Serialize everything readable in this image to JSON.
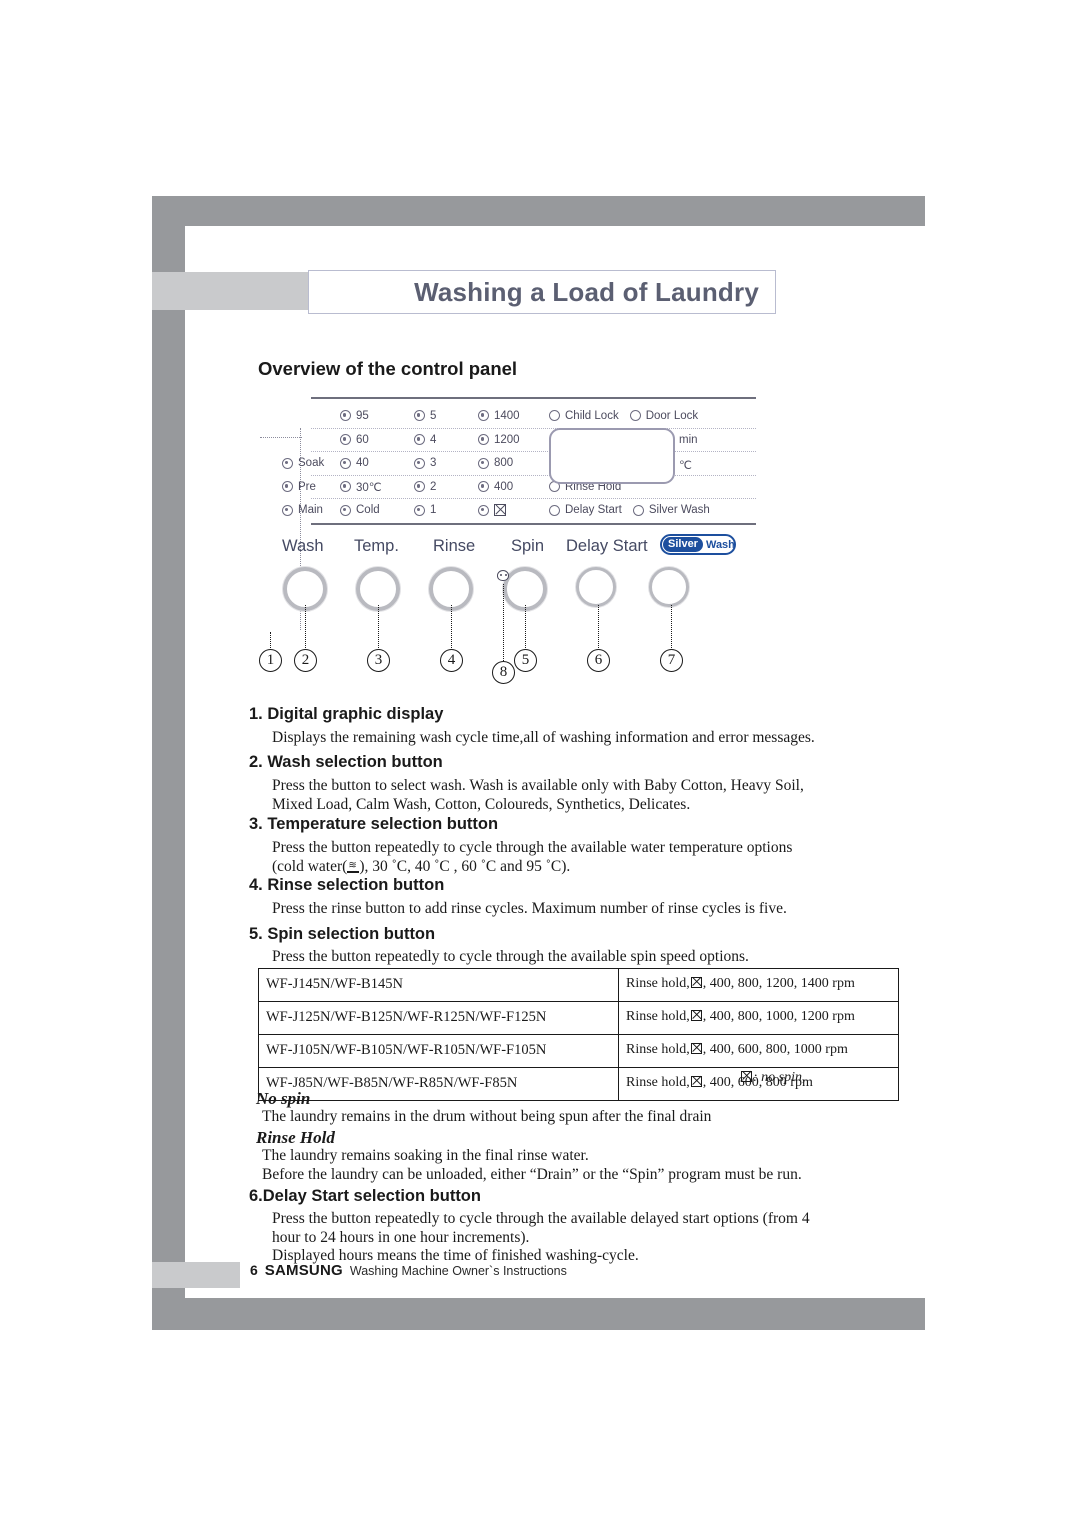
{
  "page": {
    "title": "Washing a Load of Laundry",
    "section_heading": "Overview of the control panel"
  },
  "control_panel": {
    "led_rows": [
      {
        "wash": "",
        "temp": "95",
        "rinse": "5",
        "spin": "1400",
        "spin_icon": false
      },
      {
        "wash": "",
        "temp": "60",
        "rinse": "4",
        "spin": "1200",
        "spin_icon": false
      },
      {
        "wash": "Soak",
        "temp": "40",
        "rinse": "3",
        "spin": "800",
        "spin_icon": false
      },
      {
        "wash": "Pre",
        "temp": "30℃",
        "rinse": "2",
        "spin": "400",
        "spin_icon": false
      },
      {
        "wash": "Main",
        "temp": "Cold",
        "rinse": "1",
        "spin": "",
        "spin_icon": true
      }
    ],
    "status_lights": {
      "child_lock": "Child Lock",
      "door_lock": "Door Lock",
      "rinse_hold": "Rinse Hold",
      "delay_start": "Delay Start",
      "silver_wash": "Silver Wash"
    },
    "display_units": {
      "min": "min",
      "celsius": "℃"
    },
    "buttons": [
      {
        "label": "Wash",
        "callout": "②"
      },
      {
        "label": "Temp.",
        "callout": "③"
      },
      {
        "label": "Rinse",
        "callout": "④"
      },
      {
        "label": "Spin",
        "callout": "⑤"
      },
      {
        "label": "Delay Start",
        "callout": "⑥"
      }
    ],
    "silver_wash_badge": {
      "part1": "Silver",
      "part2": "Wash",
      "callout": "⑦",
      "color": "#1d4f9e"
    },
    "callouts": [
      "1",
      "2",
      "3",
      "4",
      "5",
      "6",
      "7",
      "8"
    ]
  },
  "sections": [
    {
      "heading": "1. Digital graphic display",
      "body": "Displays the remaining wash cycle time,all of washing information and error messages."
    },
    {
      "heading": "2. Wash selection button",
      "body": "Press the button to select wash. Wash is available only with Baby Cotton, Heavy Soil,\nMixed Load, Calm Wash, Cotton, Coloureds, Synthetics, Delicates."
    },
    {
      "heading": "3. Temperature selection button",
      "body_part1": "Press the button  repeatedly to cycle through the available water temperature options",
      "body_part2": "(cold water(",
      "body_part3": "), 30 ˚C, 40 ˚C , 60 ˚C and 95 ˚C)."
    },
    {
      "heading": "4. Rinse selection button",
      "body": "Press the rinse button to add rinse cycles. Maximum number of rinse cycles is five."
    },
    {
      "heading": "5. Spin selection button",
      "body": "Press the button repeatedly to cycle through the available spin speed options."
    },
    {
      "heading": "6.Delay Start selection button",
      "body": "Press the button repeatedly to cycle through the available delayed start options (from 4\nhour to 24 hours in one hour increments).\nDisplayed hours means the time of finished washing-cycle."
    }
  ],
  "spec_table": {
    "rows": [
      {
        "model": "WF-J145N/WF-B145N",
        "spin_prefix": "Rinse hold,",
        "spin_suffix": ", 400, 800, 1200, 1400 rpm"
      },
      {
        "model": "WF-J125N/WF-B125N/WF-R125N/WF-F125N",
        "spin_prefix": "Rinse hold,",
        "spin_suffix": ", 400, 800, 1000, 1200 rpm"
      },
      {
        "model": "WF-J105N/WF-B105N/WF-R105N/WF-F105N",
        "spin_prefix": "Rinse hold,",
        "spin_suffix": ", 400, 600, 800, 1000 rpm"
      },
      {
        "model": "WF-J85N/WF-B85N/WF-R85N/WF-F85N",
        "spin_prefix": "Rinse hold,",
        "spin_suffix": ", 400, 600, 800 rpm"
      }
    ],
    "note_suffix": ": no spin,"
  },
  "definitions": [
    {
      "term": "No spin",
      "text": "The laundry remains in the drum without being spun after the final drain"
    },
    {
      "term": "Rinse Hold",
      "text": "The laundry remains soaking in the final rinse water.\nBefore the laundry can be unloaded, either “Drain” or the “Spin” program must be run."
    }
  ],
  "footer": {
    "page_number": "6",
    "brand": "SAMSUNG",
    "subtitle": "Washing Machine Owner`s Instructions"
  }
}
